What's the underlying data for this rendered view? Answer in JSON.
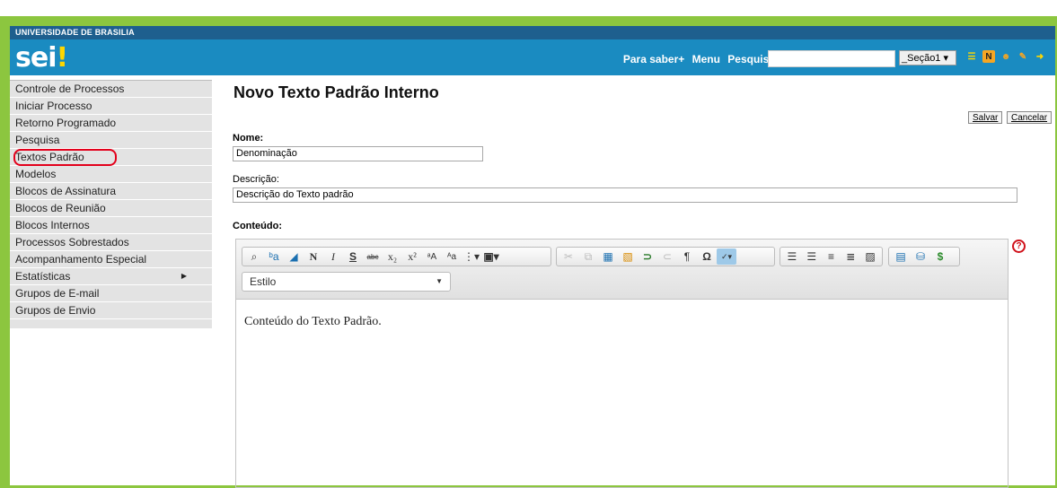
{
  "header": {
    "org": "UNIVERSIDADE DE BRASILIA",
    "logo": "sei",
    "logo_mark": "!",
    "links": [
      "Para saber+",
      "Menu",
      "Pesquisa"
    ],
    "unit_select": "_Seção1 ▾",
    "icons": [
      "list-icon",
      "notes-icon",
      "user-icon",
      "tools-icon",
      "exit-icon"
    ]
  },
  "sidebar": {
    "items": [
      {
        "label": "Controle de Processos"
      },
      {
        "label": "Iniciar Processo"
      },
      {
        "label": "Retorno Programado"
      },
      {
        "label": "Pesquisa"
      },
      {
        "label": "Textos Padrão"
      },
      {
        "label": "Modelos"
      },
      {
        "label": "Blocos de Assinatura"
      },
      {
        "label": "Blocos de Reunião"
      },
      {
        "label": "Blocos Internos"
      },
      {
        "label": "Processos Sobrestados"
      },
      {
        "label": "Acompanhamento Especial"
      },
      {
        "label": "Estatísticas"
      },
      {
        "label": "Grupos de E-mail"
      },
      {
        "label": "Grupos de Envio"
      }
    ],
    "highlighted": "Textos Padrão"
  },
  "main": {
    "title": "Novo Texto Padrão Interno",
    "save_label": "Salvar",
    "cancel_label": "Cancelar",
    "nome_label": "Nome:",
    "nome_value": "Denominação",
    "descricao_label": "Descrição:",
    "descricao_value": "Descrição do Texto padrão",
    "conteudo_label": "Conteúdo:",
    "editor": {
      "style_label": "Estilo",
      "content_text": "Conteúdo do Texto Padrão."
    }
  },
  "colors": {
    "frame": "#8cc63f",
    "header": "#1a8bc1",
    "header_band": "#1e5f8e",
    "highlight": "#e3001b"
  }
}
